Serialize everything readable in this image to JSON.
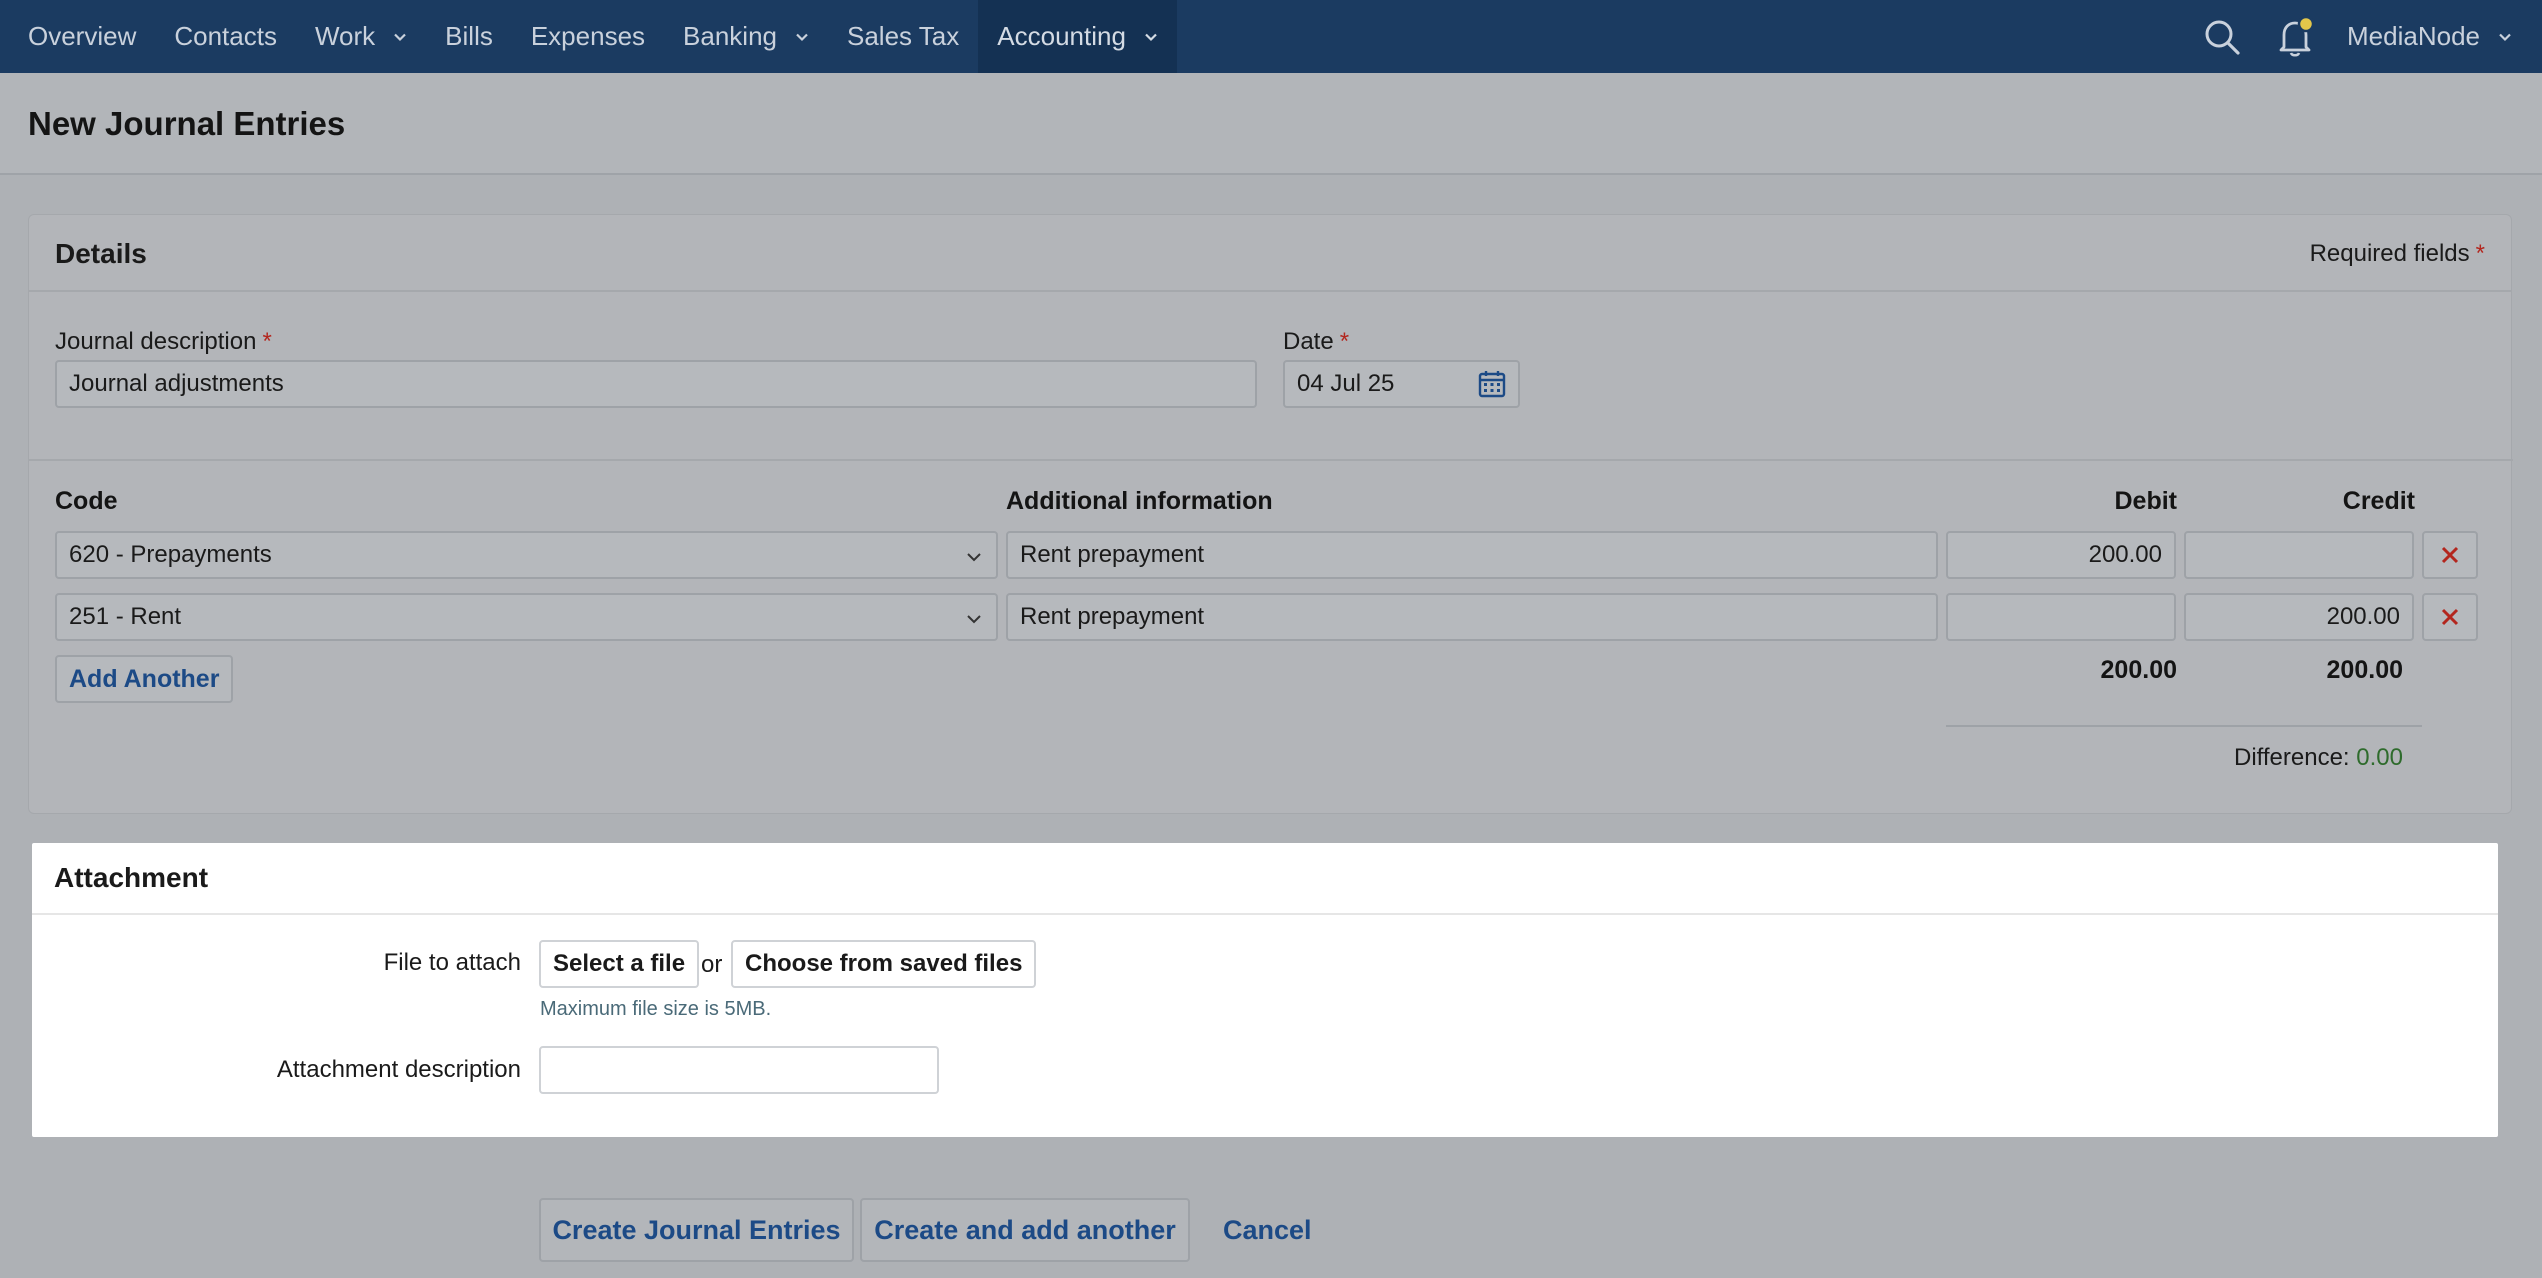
{
  "nav": {
    "items": [
      {
        "label": "Overview",
        "has_dropdown": false,
        "active": false
      },
      {
        "label": "Contacts",
        "has_dropdown": false,
        "active": false
      },
      {
        "label": "Work",
        "has_dropdown": true,
        "active": false
      },
      {
        "label": "Bills",
        "has_dropdown": false,
        "active": false
      },
      {
        "label": "Expenses",
        "has_dropdown": false,
        "active": false
      },
      {
        "label": "Banking",
        "has_dropdown": true,
        "active": false
      },
      {
        "label": "Sales Tax",
        "has_dropdown": false,
        "active": false
      },
      {
        "label": "Accounting",
        "has_dropdown": true,
        "active": true
      }
    ],
    "org_name": "MediaNode",
    "icons": [
      "search-icon",
      "notification-bell-icon",
      "chevron-down-icon"
    ]
  },
  "page": {
    "title": "New Journal Entries"
  },
  "details": {
    "heading": "Details",
    "required_note": "Required fields",
    "required_marker": "*",
    "journal_description_label": "Journal description",
    "journal_description_value": "Journal adjustments",
    "date_label": "Date",
    "date_value": "04 Jul 25"
  },
  "entries": {
    "columns": {
      "code": "Code",
      "info": "Additional information",
      "debit": "Debit",
      "credit": "Credit"
    },
    "rows": [
      {
        "code": "620 - Prepayments",
        "info": "Rent prepayment",
        "debit": "200.00",
        "credit": ""
      },
      {
        "code": "251 - Rent",
        "info": "Rent prepayment",
        "debit": "",
        "credit": "200.00"
      }
    ],
    "add_another_label": "Add Another",
    "totals": {
      "debit": "200.00",
      "credit": "200.00"
    },
    "difference_label": "Difference:",
    "difference_value": "0.00",
    "colors": {
      "difference": "#2e6b2c",
      "delete": "#b3261e"
    }
  },
  "attachment": {
    "heading": "Attachment",
    "file_label": "File to attach",
    "select_file_label": "Select a file",
    "or_text": "or",
    "saved_files_label": "Choose from saved files",
    "hint": "Maximum file size is 5MB.",
    "description_label": "Attachment description",
    "description_value": ""
  },
  "actions": {
    "create_label": "Create Journal Entries",
    "create_another_label": "Create and add another",
    "cancel_label": "Cancel"
  },
  "theme": {
    "nav_bg": "#1b3b61",
    "link": "#1c4a86",
    "required": "#b3261e"
  }
}
